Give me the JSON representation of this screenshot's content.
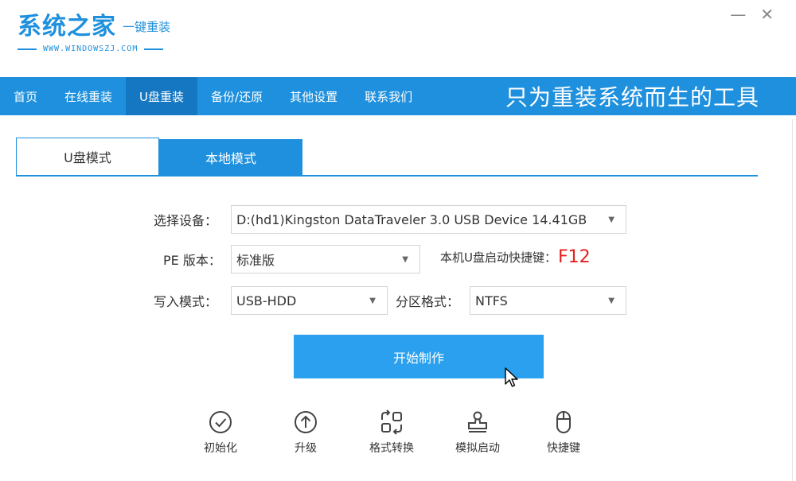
{
  "header": {
    "logo_main": "系统之家",
    "logo_sub": "一键重装",
    "logo_url": "WWW.WINDOWSZJ.COM",
    "minimize_glyph": "—",
    "close_glyph": "✕"
  },
  "nav": {
    "items": [
      "首页",
      "在线重装",
      "U盘重装",
      "备份/还原",
      "其他设置",
      "联系我们"
    ],
    "active_index": 2,
    "slogan": "只为重装系统而生的工具"
  },
  "tabs": [
    {
      "label": "U盘模式",
      "active": true
    },
    {
      "label": "本地模式",
      "active": false
    }
  ],
  "form": {
    "device_label": "选择设备：",
    "device_value": "D:(hd1)Kingston DataTraveler 3.0 USB Device 14.41GB",
    "pe_label": "PE 版本：",
    "pe_value": "标准版",
    "hotkey_label": "本机U盘启动快捷键：",
    "hotkey_value": "F12",
    "write_label": "写入模式：",
    "write_value": "USB-HDD",
    "partition_label": "分区格式：",
    "partition_value": "NTFS"
  },
  "start_button": "开始制作",
  "tools": [
    {
      "label": "初始化",
      "icon": "check-circle-icon"
    },
    {
      "label": "升级",
      "icon": "upgrade-arrow-icon"
    },
    {
      "label": "格式转换",
      "icon": "convert-icon"
    },
    {
      "label": "模拟启动",
      "icon": "stamp-icon"
    },
    {
      "label": "快捷键",
      "icon": "mouse-icon"
    }
  ],
  "colors": {
    "brand_blue": "#1e90dd",
    "nav_active": "#1577c2",
    "button_blue": "#2aa0ee",
    "hotkey_red": "#e5201f"
  }
}
